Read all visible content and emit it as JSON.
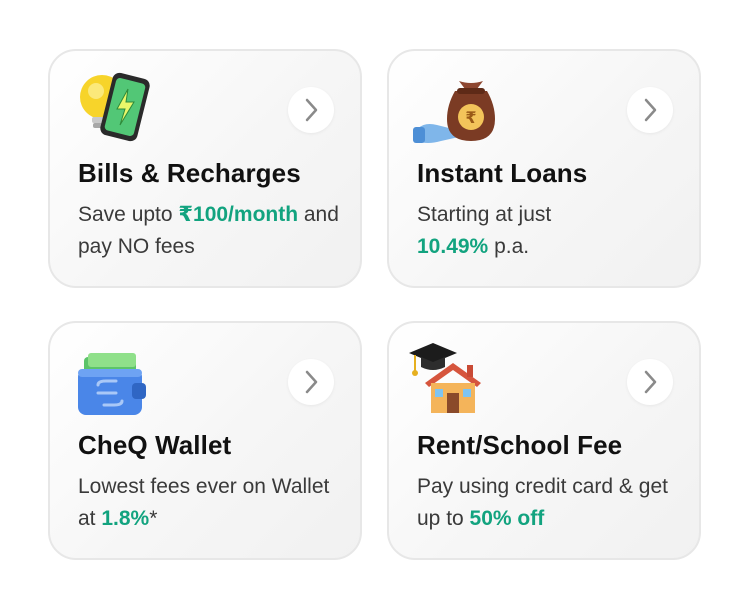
{
  "cards": [
    {
      "title": "Bills & Recharges",
      "desc_pre": "Save upto ",
      "desc_highlight": "₹100/month",
      "desc_post": " and pay NO fees",
      "icon": "lightbulb-phone-icon"
    },
    {
      "title": "Instant Loans",
      "desc_pre": "Starting at just ",
      "desc_highlight": "10.49%",
      "desc_post": " p.a.",
      "icon": "money-bag-hand-icon"
    },
    {
      "title": "CheQ Wallet",
      "desc_pre": "Lowest fees ever on Wallet at ",
      "desc_highlight": "1.8%",
      "desc_post": "*",
      "icon": "wallet-icon"
    },
    {
      "title": "Rent/School Fee",
      "desc_pre": "Pay using credit card & get up to ",
      "desc_highlight": "50% off",
      "desc_post": "",
      "icon": "house-graduation-cap-icon"
    }
  ],
  "colors": {
    "highlight": "#12a37f",
    "title": "#111111",
    "text": "#3a3a3a",
    "card_border": "#e7e7e7"
  }
}
